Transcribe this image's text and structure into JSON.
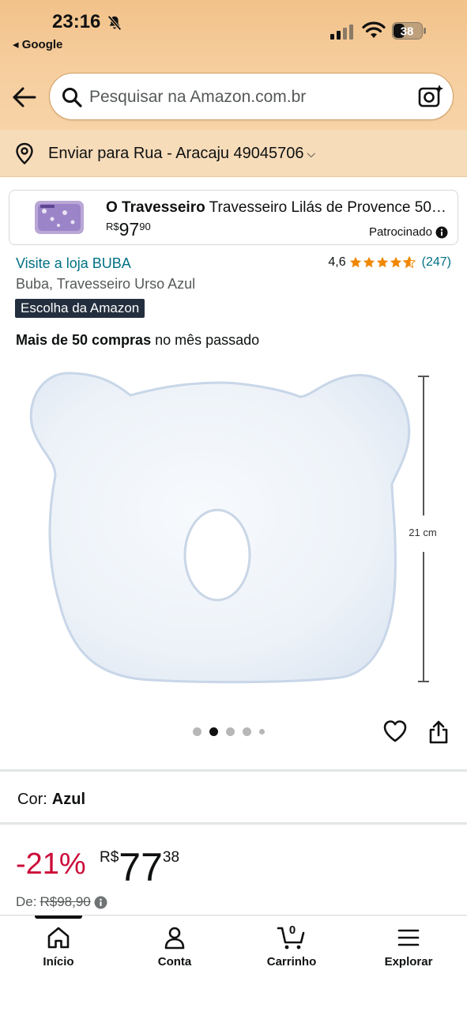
{
  "status_bar": {
    "time": "23:16",
    "back_app": "◂ Google",
    "battery": "38"
  },
  "search": {
    "placeholder": "Pesquisar na Amazon.com.br"
  },
  "delivery": {
    "label": "Enviar para Rua - Aracaju 49045706"
  },
  "sponsored": {
    "brand": "O Travesseiro",
    "title_rest": " Travesseiro Lilás de Provence 50…",
    "price_currency": "R$",
    "price_int": "97",
    "price_dec": "90",
    "label": "Patrocinado"
  },
  "product": {
    "store_link": "Visite a loja BUBA",
    "rating_value": "4,6",
    "stars": 4.6,
    "rating_count": "(247)",
    "title": "Buba, Travesseiro Urso Azul",
    "badge": "Escolha da Amazon",
    "purchases_bold": "Mais de 50 compras",
    "purchases_rest": " no mês passado",
    "dimension_label": "21 cm",
    "image_count": 5,
    "image_active": 2
  },
  "variant": {
    "label": "Cor:",
    "value": "Azul"
  },
  "pricing": {
    "discount": "-21%",
    "currency": "R$",
    "price_int": "77",
    "price_dec": "38",
    "list_label": "De:",
    "list_price": "R$98,90"
  },
  "nav": {
    "home": "Início",
    "account": "Conta",
    "cart": "Carrinho",
    "cart_count": "0",
    "explore": "Explorar"
  },
  "colors": {
    "header_bg": "#f2c28a",
    "link": "#007185",
    "discount": "#cc0c39",
    "star": "#f08804",
    "badge_bg": "#232f3e"
  },
  "icons": [
    "bell-off-icon",
    "signal-icon",
    "wifi-icon",
    "battery-icon",
    "back-arrow-icon",
    "search-icon",
    "camera-icon",
    "location-pin-icon",
    "chevron-down-icon",
    "info-icon",
    "star-icon",
    "heart-icon",
    "share-icon",
    "home-icon",
    "account-icon",
    "cart-icon",
    "menu-icon"
  ]
}
